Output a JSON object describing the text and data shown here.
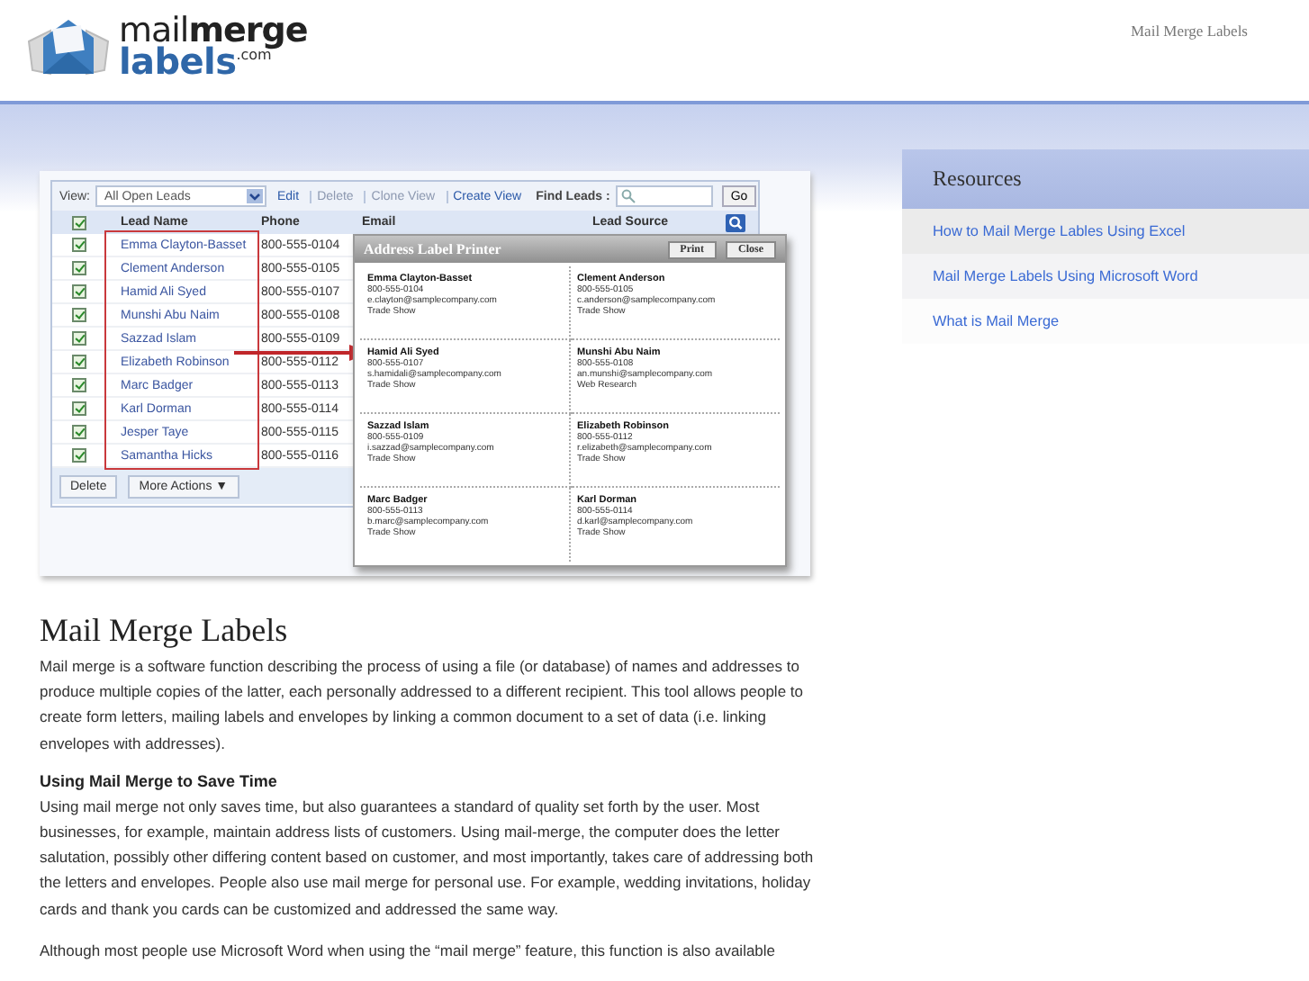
{
  "header": {
    "logo": {
      "line1": "mail**merge**",
      "line2": "labels",
      "domain": ".com"
    },
    "tagline": "Mail Merge Labels"
  },
  "screenshot": {
    "toolbar": {
      "view_label": "View:",
      "view_value": "All Open Leads",
      "actions": [
        {
          "label": "Edit",
          "disabled": false
        },
        {
          "label": "Delete",
          "disabled": true
        },
        {
          "label": "Clone View",
          "disabled": true
        },
        {
          "label": "Create View",
          "disabled": false
        }
      ],
      "find_label": "Find Leads :",
      "go": "Go"
    },
    "header_checked": true,
    "columns": [
      "Lead Name",
      "Phone",
      "Email",
      "Lead Source"
    ],
    "rows": [
      {
        "checked": true,
        "name": "Emma Clayton-Basset",
        "phone": "800-555-0104"
      },
      {
        "checked": true,
        "name": "Clement Anderson",
        "phone": "800-555-0105"
      },
      {
        "checked": true,
        "name": "Hamid Ali Syed",
        "phone": "800-555-0107"
      },
      {
        "checked": true,
        "name": "Munshi Abu Naim",
        "phone": "800-555-0108"
      },
      {
        "checked": true,
        "name": "Sazzad Islam",
        "phone": "800-555-0109"
      },
      {
        "checked": true,
        "name": "Elizabeth Robinson",
        "phone": "800-555-0112"
      },
      {
        "checked": true,
        "name": "Marc Badger",
        "phone": "800-555-0113"
      },
      {
        "checked": true,
        "name": "Karl Dorman",
        "phone": "800-555-0114"
      },
      {
        "checked": true,
        "name": "Jesper Taye",
        "phone": "800-555-0115"
      },
      {
        "checked": true,
        "name": "Samantha Hicks",
        "phone": "800-555-0116"
      }
    ],
    "footer_buttons": [
      "Delete",
      "More Actions ▼"
    ],
    "popup": {
      "title": "Address Label Printer",
      "buttons": [
        "Print",
        "Close"
      ],
      "labels": [
        {
          "name": "Emma Clayton-Basset",
          "phone": "800-555-0104",
          "email": "e.clayton@samplecompany.com",
          "source": "Trade Show"
        },
        {
          "name": "Clement Anderson",
          "phone": "800-555-0105",
          "email": "c.anderson@samplecompany.com",
          "source": "Trade Show"
        },
        {
          "name": "Hamid Ali Syed",
          "phone": "800-555-0107",
          "email": "s.hamidali@samplecompany.com",
          "source": "Trade Show"
        },
        {
          "name": "Munshi Abu Naim",
          "phone": "800-555-0108",
          "email": "an.munshi@samplecompany.com",
          "source": "Web Research"
        },
        {
          "name": "Sazzad Islam",
          "phone": "800-555-0109",
          "email": "i.sazzad@samplecompany.com",
          "source": "Trade Show"
        },
        {
          "name": "Elizabeth Robinson",
          "phone": "800-555-0112",
          "email": "r.elizabeth@samplecompany.com",
          "source": "Trade Show"
        },
        {
          "name": "Marc Badger",
          "phone": "800-555-0113",
          "email": "b.marc@samplecompany.com",
          "source": "Trade Show"
        },
        {
          "name": "Karl Dorman",
          "phone": "800-555-0114",
          "email": "d.karl@samplecompany.com",
          "source": "Trade Show"
        }
      ]
    }
  },
  "sidebar": {
    "title": "Resources",
    "links": [
      "How to Mail Merge Lables Using Excel",
      "Mail Merge Labels Using Microsoft Word",
      "What is Mail Merge"
    ]
  },
  "article": {
    "title": "Mail Merge Labels",
    "blocks": [
      {
        "kind": "paragraph",
        "text": "Mail merge is a software function describing the process of using a file (or database) of names and addresses to produce multiple copies of the latter, each personally addressed to a different recipient. This tool allows people to create form letters, mailing labels and envelopes by linking a common document to a set of data (i.e. linking envelopes with addresses)."
      },
      {
        "kind": "heading",
        "text": "Using Mail Merge to Save Time"
      },
      {
        "kind": "paragraph",
        "text": "Using mail merge not only saves time, but also guarantees a standard of quality set forth by the user. Most businesses, for example, maintain address lists of customers. Using mail-merge, the computer does the letter salutation, possibly other differing content based on customer, and most importantly, takes care of addressing both the letters and envelopes. People also use mail merge for personal use. For example, wedding invitations, holiday cards and thank you cards can be customized and addressed the same way."
      },
      {
        "kind": "paragraph",
        "text": "Although most people use Microsoft Word when using the “mail merge” feature, this function is also available"
      }
    ]
  }
}
